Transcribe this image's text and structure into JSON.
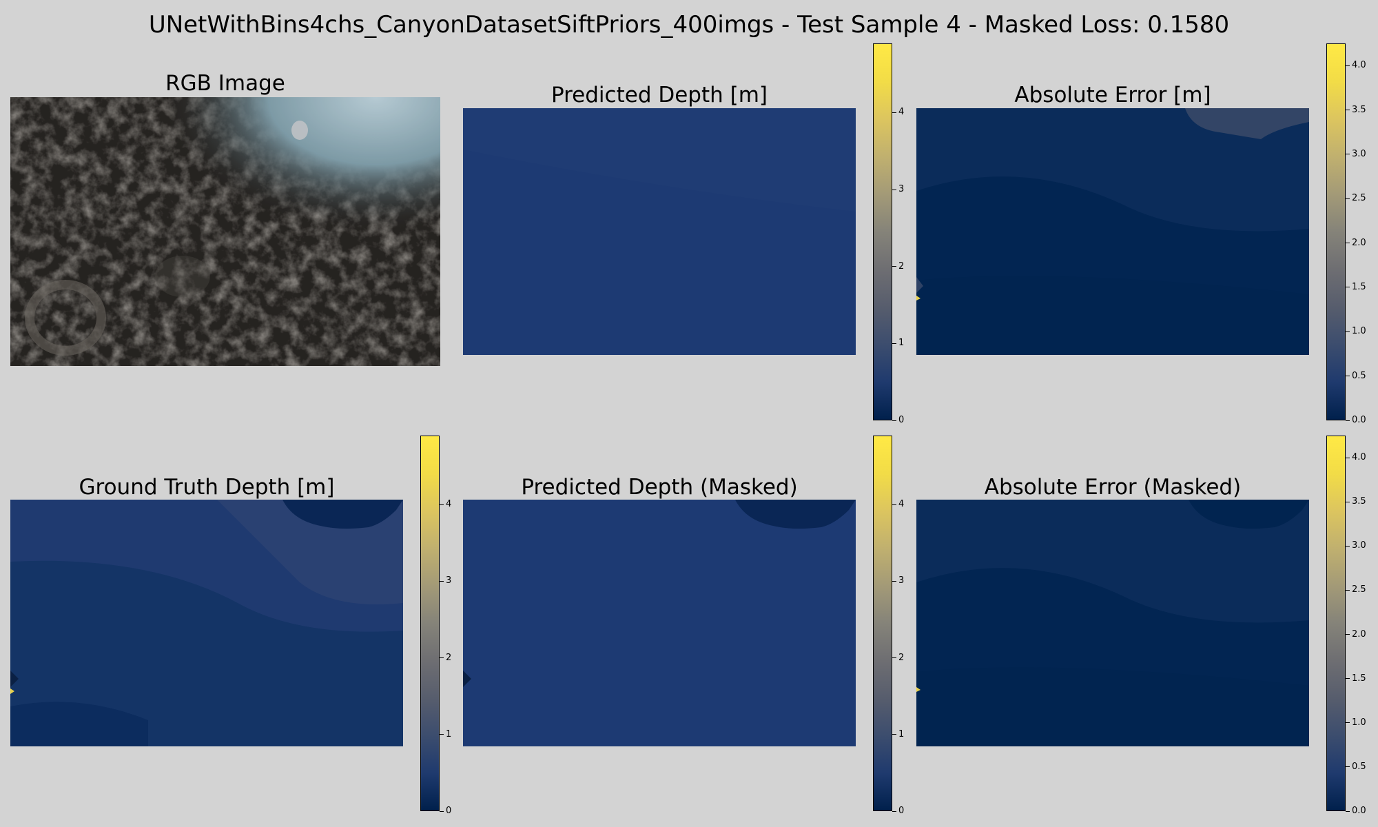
{
  "title": "UNetWithBins4chs_CanyonDatasetSiftPriors_400imgs - Test Sample 4 - Masked Loss: 0.1580",
  "panels": [
    {
      "title": "RGB Image"
    },
    {
      "title": "Predicted Depth [m]"
    },
    {
      "title": "Absolute Error [m]"
    },
    {
      "title": "Ground Truth Depth [m]"
    },
    {
      "title": "Predicted Depth (Masked)"
    },
    {
      "title": "Absolute Error (Masked)"
    }
  ],
  "colormap": "cividis",
  "chart_data": [
    {
      "type": "heatmap",
      "title": "RGB Image",
      "content": "underwater photo"
    },
    {
      "type": "heatmap",
      "title": "Predicted Depth [m]",
      "colorbar": {
        "ticks": [
          "0",
          "1",
          "2",
          "3",
          "4"
        ],
        "range": [
          0,
          4.9
        ]
      }
    },
    {
      "type": "heatmap",
      "title": "Absolute Error [m]",
      "colorbar": {
        "ticks": [
          "0.0",
          "0.5",
          "1.0",
          "1.5",
          "2.0",
          "2.5",
          "3.0",
          "3.5",
          "4.0"
        ],
        "range": [
          0,
          4.25
        ]
      }
    },
    {
      "type": "heatmap",
      "title": "Ground Truth Depth [m]",
      "colorbar": {
        "ticks": [
          "0",
          "1",
          "2",
          "3",
          "4"
        ],
        "range": [
          0,
          4.9
        ]
      }
    },
    {
      "type": "heatmap",
      "title": "Predicted Depth (Masked)",
      "colorbar": {
        "ticks": [
          "0",
          "1",
          "2",
          "3",
          "4"
        ],
        "range": [
          0,
          4.9
        ]
      }
    },
    {
      "type": "heatmap",
      "title": "Absolute Error (Masked)",
      "colorbar": {
        "ticks": [
          "0.0",
          "0.5",
          "1.0",
          "1.5",
          "2.0",
          "2.5",
          "3.0",
          "3.5",
          "4.0"
        ],
        "range": [
          0,
          4.25
        ]
      }
    }
  ]
}
